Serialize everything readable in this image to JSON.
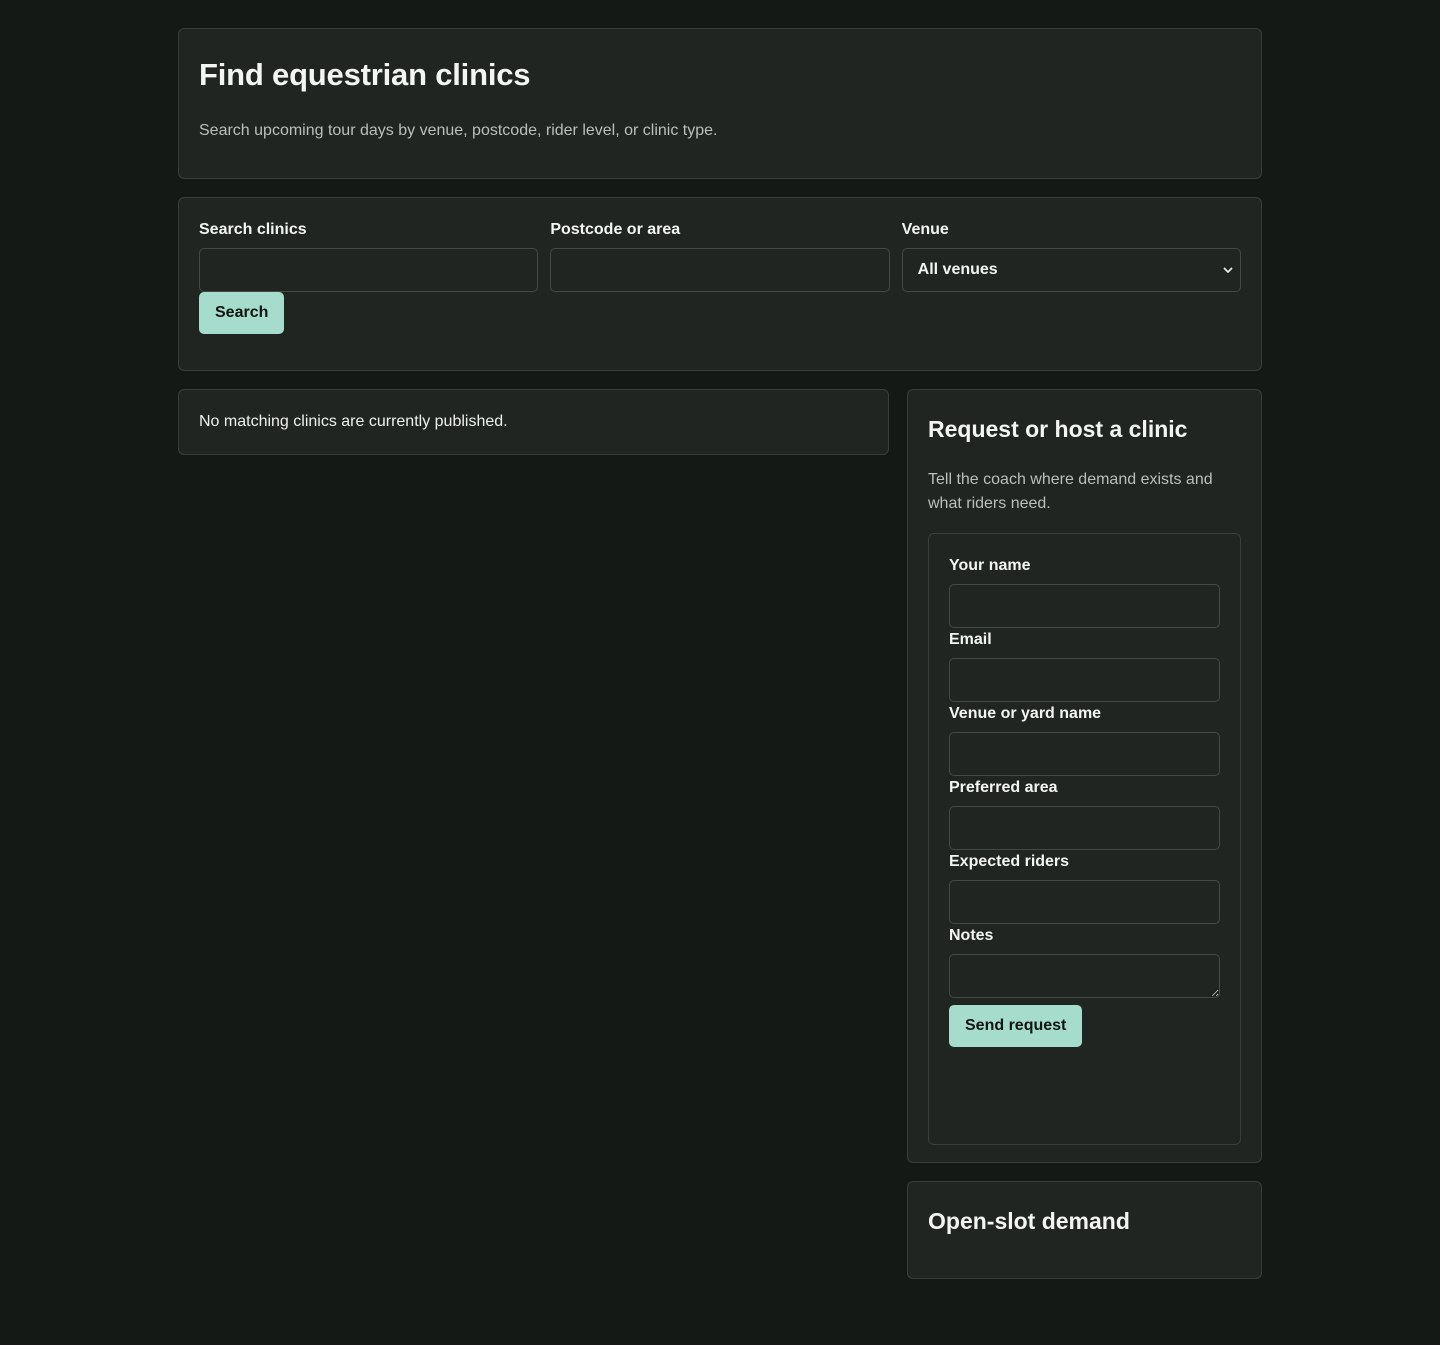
{
  "hero": {
    "title": "Find equestrian clinics",
    "subtitle": "Search upcoming tour days by venue, postcode, rider level, or clinic type."
  },
  "search": {
    "query_label": "Search clinics",
    "query_value": "",
    "postcode_label": "Postcode or area",
    "postcode_value": "",
    "venue_label": "Venue",
    "venue_selected": "All venues",
    "button_label": "Search"
  },
  "results": {
    "empty_message": "No matching clinics are currently published."
  },
  "request": {
    "title": "Request or host a clinic",
    "subtitle": "Tell the coach where demand exists and what riders need.",
    "fields": {
      "name_label": "Your name",
      "email_label": "Email",
      "venue_label": "Venue or yard name",
      "area_label": "Preferred area",
      "riders_label": "Expected riders",
      "notes_label": "Notes"
    },
    "submit_label": "Send request"
  },
  "demand": {
    "title": "Open-slot demand"
  },
  "colors": {
    "background": "#151916",
    "card": "#202522",
    "border": "#383e3a",
    "accent": "#a6dccb"
  }
}
